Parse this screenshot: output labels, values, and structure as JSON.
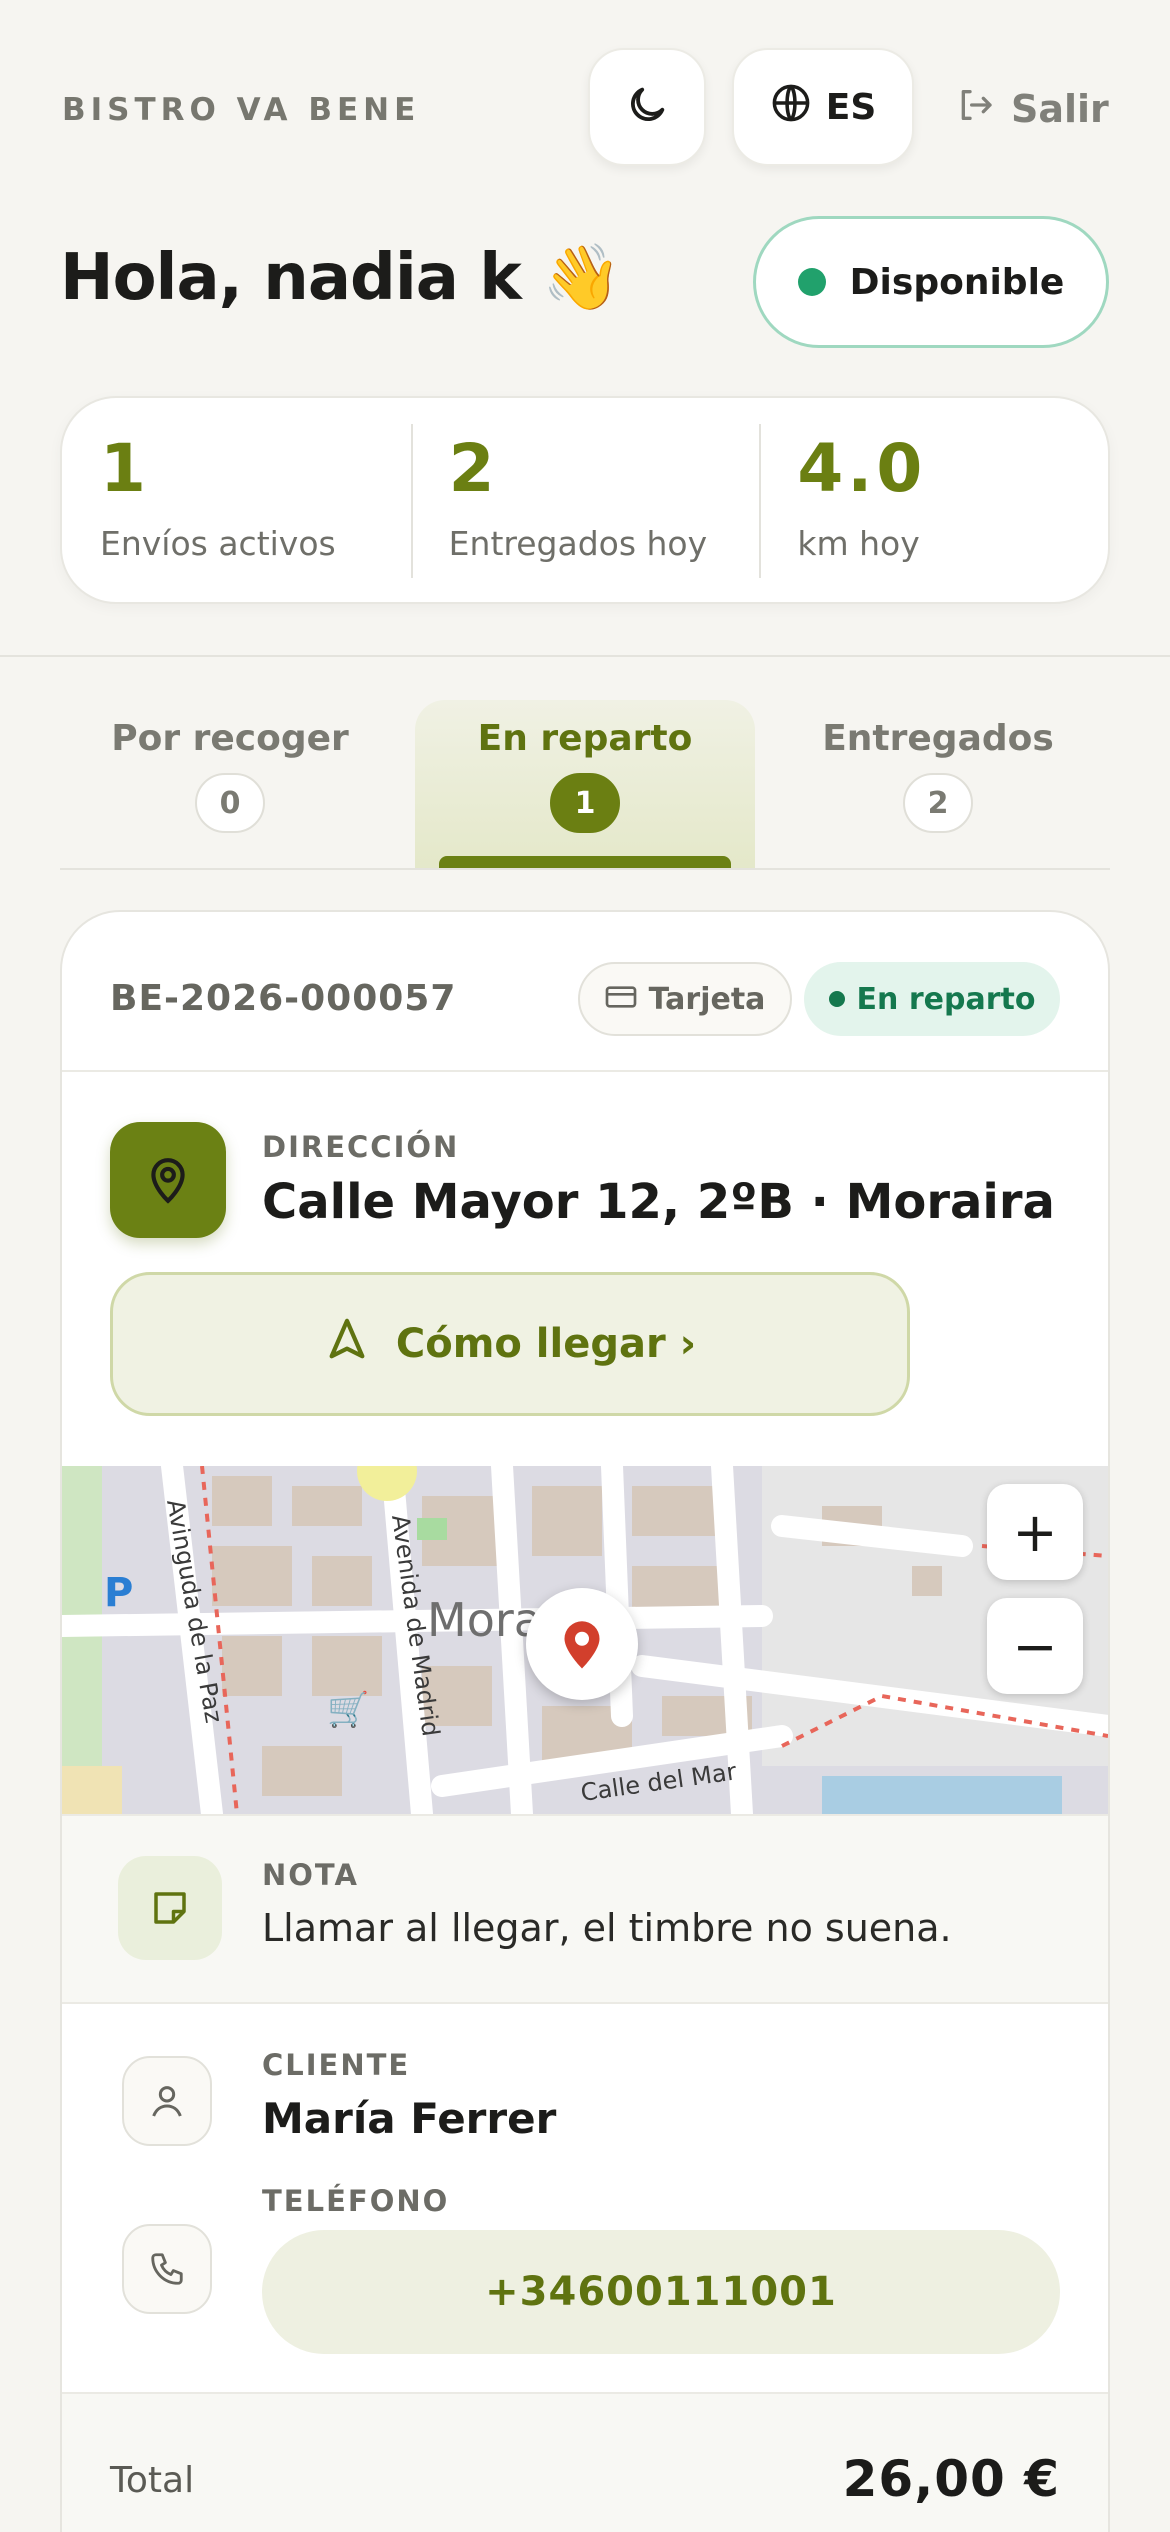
{
  "header": {
    "brand": "BISTRO VA BENE",
    "language": "ES",
    "logout_label": "Salir"
  },
  "greeting": "Hola, nadia k 👋",
  "availability": {
    "label": "Disponible",
    "color": "#21a16c"
  },
  "stats": [
    {
      "value": "1",
      "label": "Envíos activos"
    },
    {
      "value": "2",
      "label": "Entregados hoy"
    },
    {
      "value": "4.0",
      "label": "km hoy"
    }
  ],
  "tabs": [
    {
      "label": "Por recoger",
      "count": "0"
    },
    {
      "label": "En reparto",
      "count": "1",
      "active": true
    },
    {
      "label": "Entregados",
      "count": "2"
    }
  ],
  "order": {
    "id": "BE-2026-000057",
    "payment": "Tarjeta",
    "state": "En reparto",
    "address_label": "DIRECCIÓN",
    "address": "Calle Mayor 12, 2ºB · Moraira",
    "directions_label": "Cómo llegar ›",
    "map": {
      "labels": [
        "Avinguda de la Paz",
        "Avenida de Madrid",
        "Mora",
        "Calle del Mar",
        "P"
      ],
      "zoom_in": "+",
      "zoom_out": "−"
    },
    "note_label": "NOTA",
    "note": "Llamar al llegar, el timbre no suena.",
    "client_label": "CLIENTE",
    "client": "María Ferrer",
    "phone_label": "TELÉFONO",
    "phone": "+34600111001",
    "total_label": "Total",
    "total": "26,00 €"
  },
  "colors": {
    "accent": "#6b8114",
    "accent_text": "#5f7310",
    "status_green": "#15784e",
    "background": "#f6f5f1"
  }
}
